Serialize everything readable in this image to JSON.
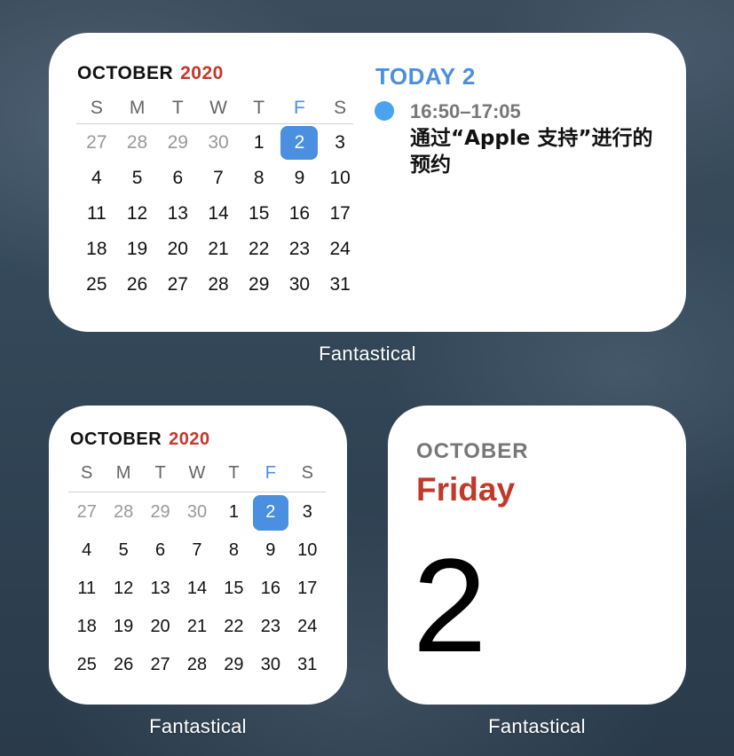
{
  "large_widget": {
    "month": "OCTOBER",
    "year": "2020",
    "weekdays": [
      "S",
      "M",
      "T",
      "W",
      "T",
      "F",
      "S"
    ],
    "highlight_weekday_index": 5,
    "days": [
      [
        "27",
        "28",
        "29",
        "30",
        "1",
        "2",
        "3"
      ],
      [
        "4",
        "5",
        "6",
        "7",
        "8",
        "9",
        "10"
      ],
      [
        "11",
        "12",
        "13",
        "14",
        "15",
        "16",
        "17"
      ],
      [
        "18",
        "19",
        "20",
        "21",
        "22",
        "23",
        "24"
      ],
      [
        "25",
        "26",
        "27",
        "28",
        "29",
        "30",
        "31"
      ]
    ],
    "today": "2",
    "events_header": "TODAY 2",
    "event": {
      "time": "16:50–17:05",
      "title": "通过“Apple 支持”进行的预约",
      "color": "#4aa3ee"
    },
    "label": "Fantastical"
  },
  "small_widget": {
    "month": "OCTOBER",
    "year": "2020",
    "weekdays": [
      "S",
      "M",
      "T",
      "W",
      "T",
      "F",
      "S"
    ],
    "days": [
      [
        "27",
        "28",
        "29",
        "30",
        "1",
        "2",
        "3"
      ],
      [
        "4",
        "5",
        "6",
        "7",
        "8",
        "9",
        "10"
      ],
      [
        "11",
        "12",
        "13",
        "14",
        "15",
        "16",
        "17"
      ],
      [
        "18",
        "19",
        "20",
        "21",
        "22",
        "23",
        "24"
      ],
      [
        "25",
        "26",
        "27",
        "28",
        "29",
        "30",
        "31"
      ]
    ],
    "today": "2",
    "label": "Fantastical"
  },
  "day_widget": {
    "month": "OCTOBER",
    "weekday": "Friday",
    "day": "2",
    "label": "Fantastical"
  },
  "colors": {
    "accent_blue": "#4a8fe0",
    "accent_red": "#c0392b"
  }
}
